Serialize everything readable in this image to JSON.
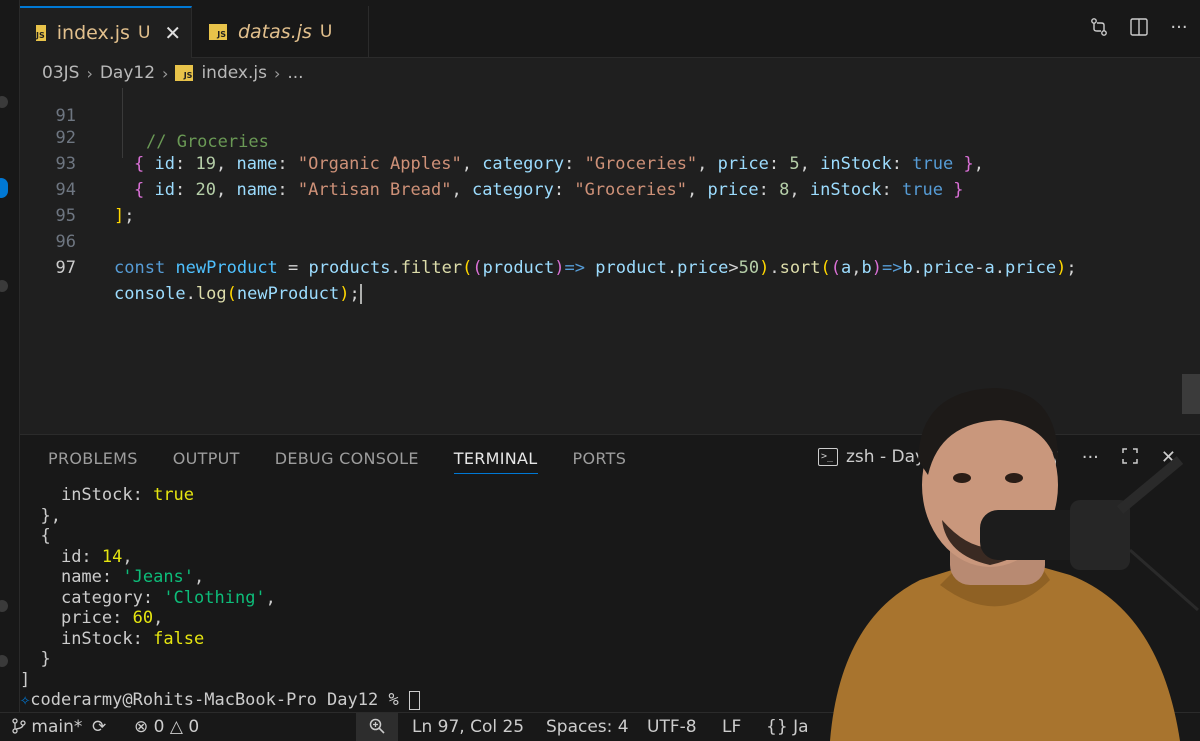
{
  "tabs": [
    {
      "name": "index.js",
      "status": "U",
      "badge": "JS",
      "active": true
    },
    {
      "name": "datas.js",
      "status": "U",
      "badge": "JS",
      "active": false
    }
  ],
  "breadcrumb": {
    "part1": "03JS",
    "part2": "Day12",
    "badge": "JS",
    "file": "index.js",
    "more": "..."
  },
  "editor": {
    "lines": [
      {
        "num": "91",
        "text": "// Groceries"
      },
      {
        "num": "92",
        "text": "{ id: 19, name: \"Organic Apples\", category: \"Groceries\", price: 5, inStock: true },"
      },
      {
        "num": "93",
        "text": "{ id: 20, name: \"Artisan Bread\", category: \"Groceries\", price: 8, inStock: true }"
      },
      {
        "num": "94",
        "text": "];"
      },
      {
        "num": "95",
        "text": ""
      },
      {
        "num": "96",
        "text": "const newProduct = products.filter((product)=> product.price>50).sort((a,b)=>b.price-a.price);"
      },
      {
        "num": "97",
        "text": "console.log(newProduct);"
      }
    ]
  },
  "panel": {
    "tabs": [
      "PROBLEMS",
      "OUTPUT",
      "DEBUG CONSOLE",
      "TERMINAL",
      "PORTS"
    ],
    "active_tab": "TERMINAL",
    "terminal_name": "zsh - Day",
    "terminal_lines": [
      "    inStock: true",
      "  },",
      "  {",
      "    id: 14,",
      "    name: 'Jeans',",
      "    category: 'Clothing',",
      "    price: 60,",
      "    inStock: false",
      "  }",
      "]"
    ],
    "prompt": "coderarmy@Rohits-MacBook-Pro Day12 %"
  },
  "statusbar": {
    "branch": "main*",
    "errors": "0",
    "warnings": "0",
    "position": "Ln 97, Col 25",
    "spaces": "Spaces: 4",
    "encoding": "UTF-8",
    "eol": "LF",
    "language": "Ja"
  },
  "icons": [
    "compare-changes-icon",
    "split-editor-icon",
    "more-icon",
    "trash-icon",
    "maximize-icon",
    "sync-icon",
    "error-icon",
    "warning-icon",
    "zoom-icon",
    "braces-icon",
    "branch-icon",
    "terminal-icon",
    "copilot-icon"
  ],
  "colors": {
    "accent": "#0078d4",
    "editor_bg": "#1f1f1f",
    "panel_bg": "#181818",
    "js_badge": "#e8c34a",
    "modified": "#e2c08d"
  }
}
